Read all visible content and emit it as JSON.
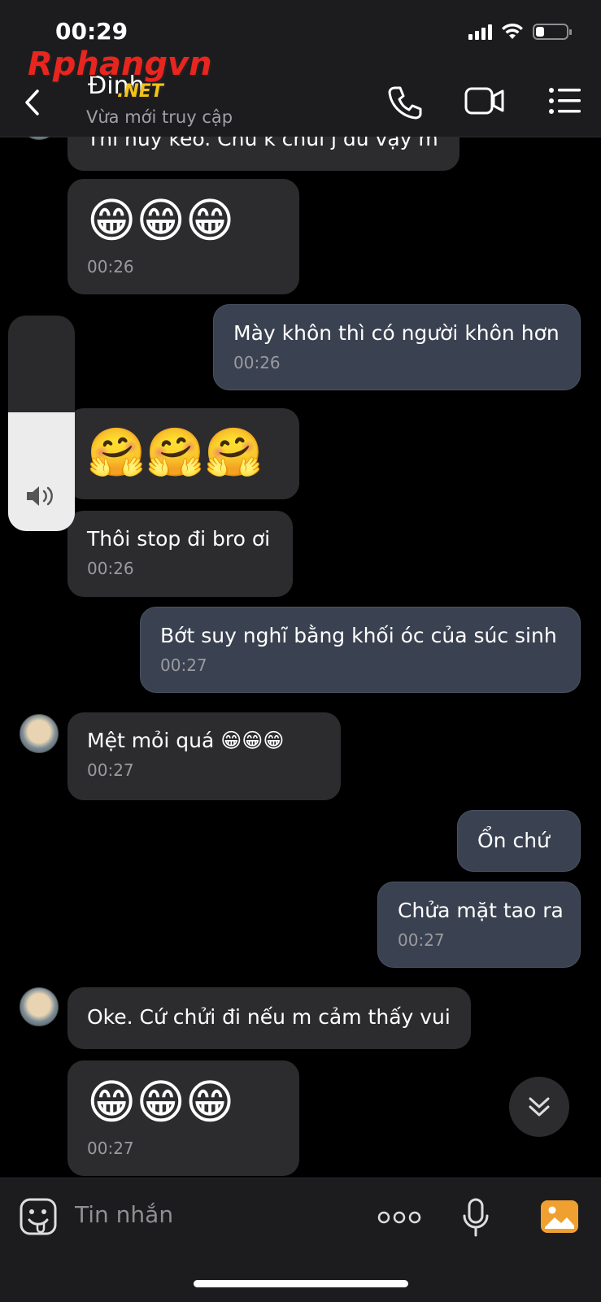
{
  "status_bar": {
    "time": "00:29",
    "battery_percent": 30
  },
  "watermark": {
    "text": "Rphangvn",
    "suffix": ".NET"
  },
  "header": {
    "contact_name": "Đình",
    "contact_status": "Vừa mới truy cập"
  },
  "messages": [
    {
      "dir": "in",
      "text": "Thì huỷ kèo. Chứ k chửi j dù vậy m",
      "time": ""
    },
    {
      "dir": "in",
      "emoji": "😁😁😁",
      "time": "00:26"
    },
    {
      "dir": "out",
      "text": "Mày khôn thì có người khôn hơn",
      "time": "00:26"
    },
    {
      "dir": "in",
      "emoji": "🤗🤗🤗",
      "time": ""
    },
    {
      "dir": "in",
      "text": "Thôi stop đi bro ơi",
      "time": "00:26"
    },
    {
      "dir": "out",
      "text": "Bớt suy nghĩ bằng khối óc của súc sinh",
      "time": "00:27"
    },
    {
      "dir": "in",
      "text": "Mệt mỏi quá 😁😁😁",
      "time": "00:27"
    },
    {
      "dir": "out",
      "text": "Ổn chứ",
      "time": ""
    },
    {
      "dir": "out",
      "text": "Chửa mặt tao ra",
      "time": "00:27"
    },
    {
      "dir": "in",
      "text": "Oke. Cứ chửi đi nếu m cảm thấy vui",
      "time": ""
    },
    {
      "dir": "in",
      "emoji": "😁😁😁",
      "time": "00:27"
    }
  ],
  "volume": {
    "level": 0.55,
    "icon": "speaker-icon"
  },
  "composer": {
    "placeholder": "Tin nhắn"
  },
  "colors": {
    "incoming": "#2c2c2e",
    "outgoing": "#3a4150",
    "background": "#000000"
  }
}
